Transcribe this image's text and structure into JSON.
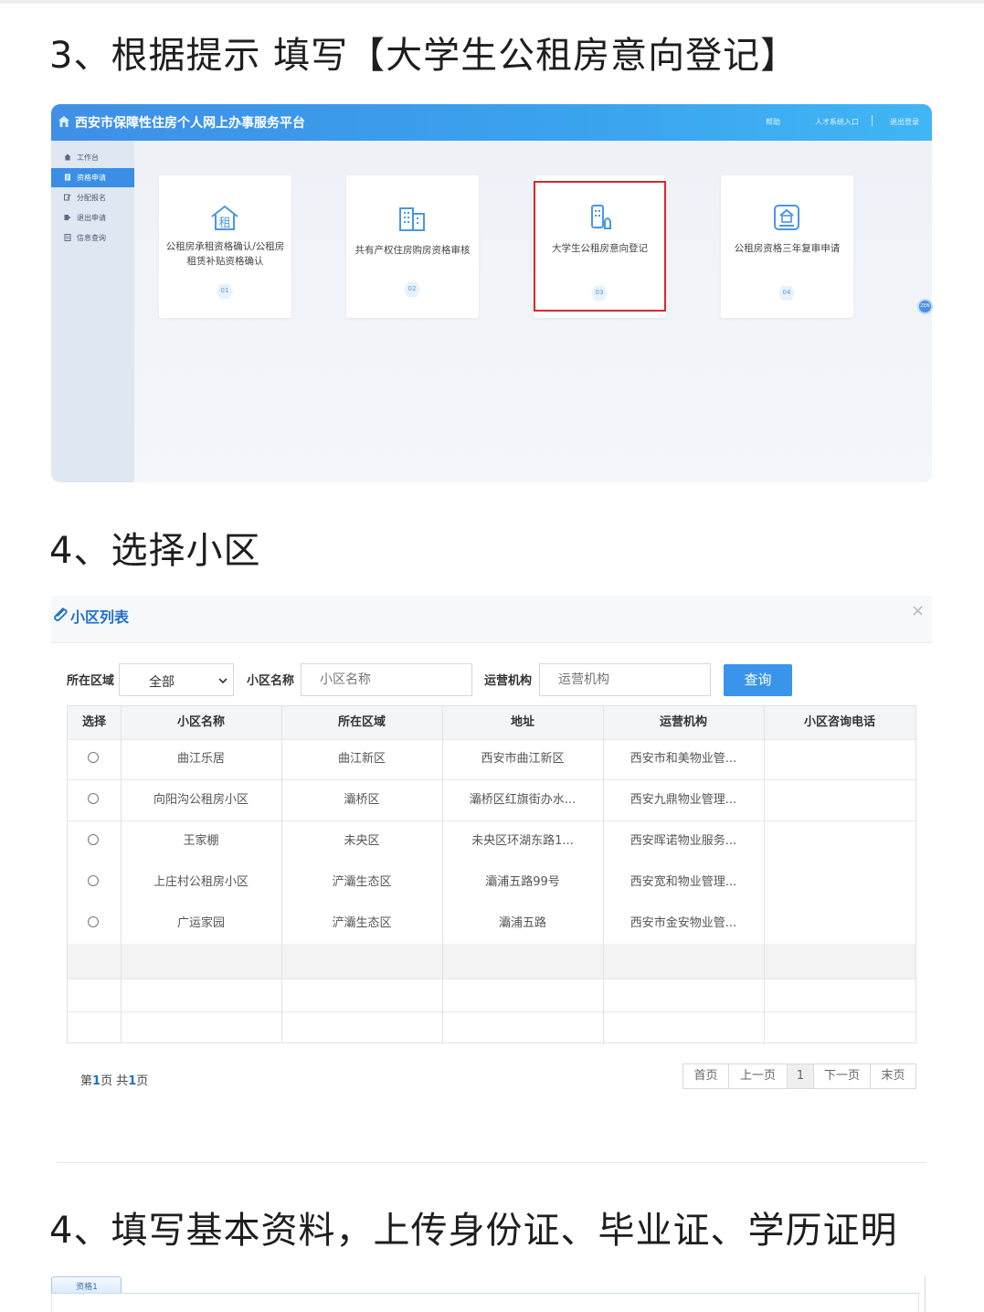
{
  "headings": {
    "step3": "3、根据提示 填写【大学生公租房意向登记】",
    "step4a": "4、选择小区",
    "step4b": "4、填写基本资料，上传身份证、毕业证、学历证明"
  },
  "portal": {
    "title": "西安市保障性住房个人网上办事服务平台",
    "links": {
      "help": "帮助",
      "talent": "人才系统入口",
      "logout": "退出登录"
    },
    "sidebar": [
      {
        "label": "工作台",
        "icon": "home-icon"
      },
      {
        "label": "资格申请",
        "icon": "document-icon",
        "active": true
      },
      {
        "label": "分配报名",
        "icon": "edit-icon"
      },
      {
        "label": "退出申请",
        "icon": "exit-icon"
      },
      {
        "label": "信息查询",
        "icon": "list-icon"
      }
    ],
    "cards": [
      {
        "label_line1": "公租房承租资格确认/公租房",
        "label_line2": "租赁补贴资格确认",
        "num": "01",
        "icon": "house-rent-icon"
      },
      {
        "label_line1": "共有产权住房购房资格审核",
        "num": "02",
        "icon": "building-icon"
      },
      {
        "label_line1": "大学生公租房意向登记",
        "num": "03",
        "icon": "phone-building-icon",
        "highlighted": true
      },
      {
        "label_line1": "公租房资格三年复审申请",
        "num": "04",
        "icon": "house-review-icon"
      }
    ],
    "float_button": "ZEN",
    "accent_color": "#3a8ee6",
    "highlight_color": "#d8282a"
  },
  "modal": {
    "title": "小区列表",
    "close": "×",
    "filters": {
      "area_label": "所在区域",
      "area_value": "全部",
      "name_label": "小区名称",
      "name_placeholder": "小区名称",
      "org_label": "运营机构",
      "org_placeholder": "运营机构",
      "query_button": "查询"
    },
    "columns": [
      "选择",
      "小区名称",
      "所在区域",
      "地址",
      "运营机构",
      "小区咨询电话"
    ],
    "rows": [
      {
        "name": "曲江乐居",
        "area": "曲江新区",
        "address": "西安市曲江新区",
        "org": "西安市和美物业管...",
        "phone": ""
      },
      {
        "name": "向阳沟公租房小区",
        "area": "灞桥区",
        "address": "灞桥区红旗街办水...",
        "org": "西安九鼎物业管理...",
        "phone": ""
      },
      {
        "name": "王家棚",
        "area": "未央区",
        "address": "未央区环湖东路1...",
        "org": "西安晖诺物业服务...",
        "phone": ""
      },
      {
        "name": "上庄村公租房小区",
        "area": "浐灞生态区",
        "address": "灞浦五路99号",
        "org": "西安宽和物业管理...",
        "phone": ""
      },
      {
        "name": "广运家园",
        "area": "浐灞生态区",
        "address": "灞浦五路",
        "org": "西安市金安物业管...",
        "phone": ""
      }
    ],
    "pagination": {
      "info_prefix": "第",
      "current": "1",
      "info_mid": "页 共",
      "total": "1",
      "info_suffix": "页",
      "first": "首页",
      "prev": "上一页",
      "page": "1",
      "next": "下一页",
      "last": "末页"
    }
  },
  "form": {
    "tab": "资格1"
  }
}
